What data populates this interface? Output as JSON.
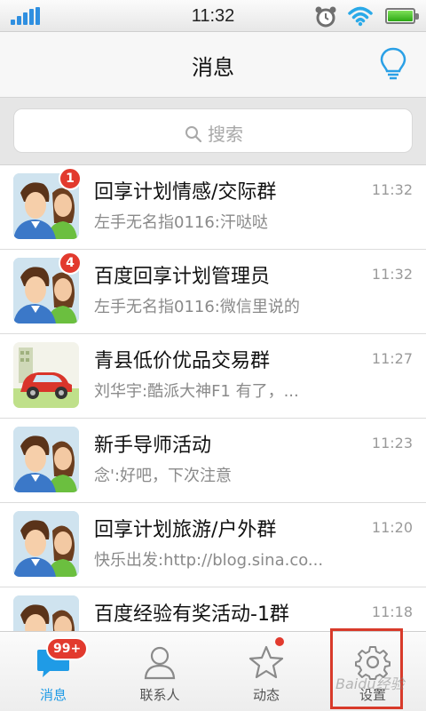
{
  "status_bar": {
    "time": "11:32",
    "signal_icon": "signal-bars-icon",
    "alarm_icon": "alarm-clock-icon",
    "wifi_icon": "wifi-icon",
    "battery_icon": "battery-icon",
    "battery_level": 0.92
  },
  "header": {
    "title": "消息",
    "idea_icon": "lightbulb-icon"
  },
  "search": {
    "placeholder": "搜索",
    "icon": "search-icon"
  },
  "conversations": [
    {
      "name": "回享计划情感/交际群",
      "preview": "左手无名指0116:汗哒哒",
      "time": "11:32",
      "badge": "1",
      "avatar": "couple-avatar"
    },
    {
      "name": "百度回享计划管理员",
      "preview": "左手无名指0116:微信里说的",
      "time": "11:32",
      "badge": "4",
      "avatar": "couple-avatar"
    },
    {
      "name": "青县低价优品交易群",
      "preview": "刘华宇:酷派大神F1 有了，...",
      "time": "11:27",
      "badge": "",
      "avatar": "red-car-avatar"
    },
    {
      "name": "新手导师活动",
      "preview": "念':好吧，下次注意",
      "time": "11:23",
      "badge": "",
      "avatar": "couple-avatar"
    },
    {
      "name": "回享计划旅游/户外群",
      "preview": "快乐出发:http://blog.sina.co...",
      "time": "11:20",
      "badge": "",
      "avatar": "couple-avatar"
    },
    {
      "name": "百度经验有奖活动-1群",
      "preview": "",
      "time": "11:18",
      "badge": "",
      "avatar": "couple-avatar"
    }
  ],
  "tabs": [
    {
      "label": "消息",
      "icon": "chat-bubble-icon",
      "badge": "99+",
      "active": true
    },
    {
      "label": "联系人",
      "icon": "person-icon",
      "active": false
    },
    {
      "label": "动态",
      "icon": "star-icon",
      "active": false,
      "dot": true
    },
    {
      "label": "设置",
      "icon": "gear-icon",
      "active": false
    }
  ],
  "watermark": "Baidu经验",
  "colors": {
    "accent": "#1f9be6",
    "badge": "#e23a2e",
    "highlight_box": "#d83a2a"
  }
}
